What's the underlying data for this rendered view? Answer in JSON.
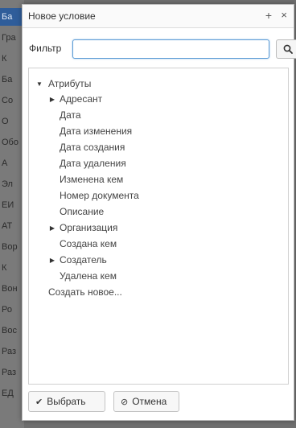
{
  "background": {
    "rows": [
      "Ба",
      "Гра",
      "К",
      "Ба",
      "Со",
      "О",
      "Обо",
      "А",
      "Эл",
      "ЕИ",
      "АТ",
      "Вор",
      "К",
      "Вон",
      "Ро",
      "Вос",
      "Раз",
      "Раз",
      "ЕД"
    ]
  },
  "dialog": {
    "title": "Новое условие",
    "maximize_symbol": "+",
    "close_symbol": "×"
  },
  "filter": {
    "label": "Фильтр",
    "value": "",
    "placeholder": ""
  },
  "tree": {
    "root_label": "Атрибуты",
    "items": [
      {
        "label": "Адресант",
        "expandable": true
      },
      {
        "label": "Дата",
        "expandable": false
      },
      {
        "label": "Дата изменения",
        "expandable": false
      },
      {
        "label": "Дата создания",
        "expandable": false
      },
      {
        "label": "Дата удаления",
        "expandable": false
      },
      {
        "label": "Изменена кем",
        "expandable": false
      },
      {
        "label": "Номер документа",
        "expandable": false
      },
      {
        "label": "Описание",
        "expandable": false
      },
      {
        "label": "Организация",
        "expandable": true
      },
      {
        "label": "Создана кем",
        "expandable": false
      },
      {
        "label": "Создатель",
        "expandable": true
      },
      {
        "label": "Удалена кем",
        "expandable": false
      }
    ],
    "create_new_label": "Создать новое..."
  },
  "footer": {
    "select_label": "Выбрать",
    "cancel_label": "Отмена"
  },
  "colors": {
    "accent": "#5b9bd5",
    "selected_bg": "#2f5d9a"
  }
}
